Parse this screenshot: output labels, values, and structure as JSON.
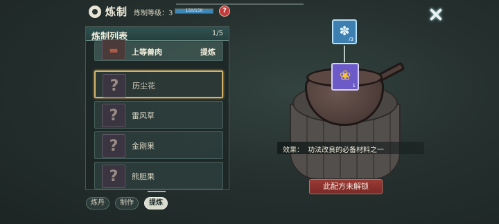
{
  "header": {
    "title": "炼制",
    "level_label": "炼制等级：3",
    "level_progress": "150/150",
    "level_fraction": 1.0,
    "help_label": "?"
  },
  "list_panel": {
    "title": "炼制列表",
    "page": "1/5",
    "items": [
      {
        "name": "上等兽肉",
        "action": "提炼",
        "icon": "meat-icon"
      },
      {
        "name": "历尘花",
        "icon": "unknown-icon",
        "icon_text": "?"
      },
      {
        "name": "雷风草",
        "icon": "unknown-icon",
        "icon_text": "?"
      },
      {
        "name": "金刚果",
        "icon": "unknown-icon",
        "icon_text": "?"
      },
      {
        "name": "熊胆果",
        "icon": "unknown-icon",
        "icon_text": "?"
      }
    ]
  },
  "tabs": [
    {
      "label": "炼丹"
    },
    {
      "label": "制作"
    },
    {
      "label": "提炼",
      "active": true
    }
  ],
  "crafting": {
    "ingredient_count": "/3",
    "output_count": "1",
    "effect_label": "效果：",
    "effect_text": "功法改良的必备材料之一",
    "unlock_button": "此配方未解锁"
  },
  "colors": {
    "accent_gold": "#d3b36a",
    "progress_blue": "#3c86b8",
    "unlock_red": "#9b3a34"
  }
}
